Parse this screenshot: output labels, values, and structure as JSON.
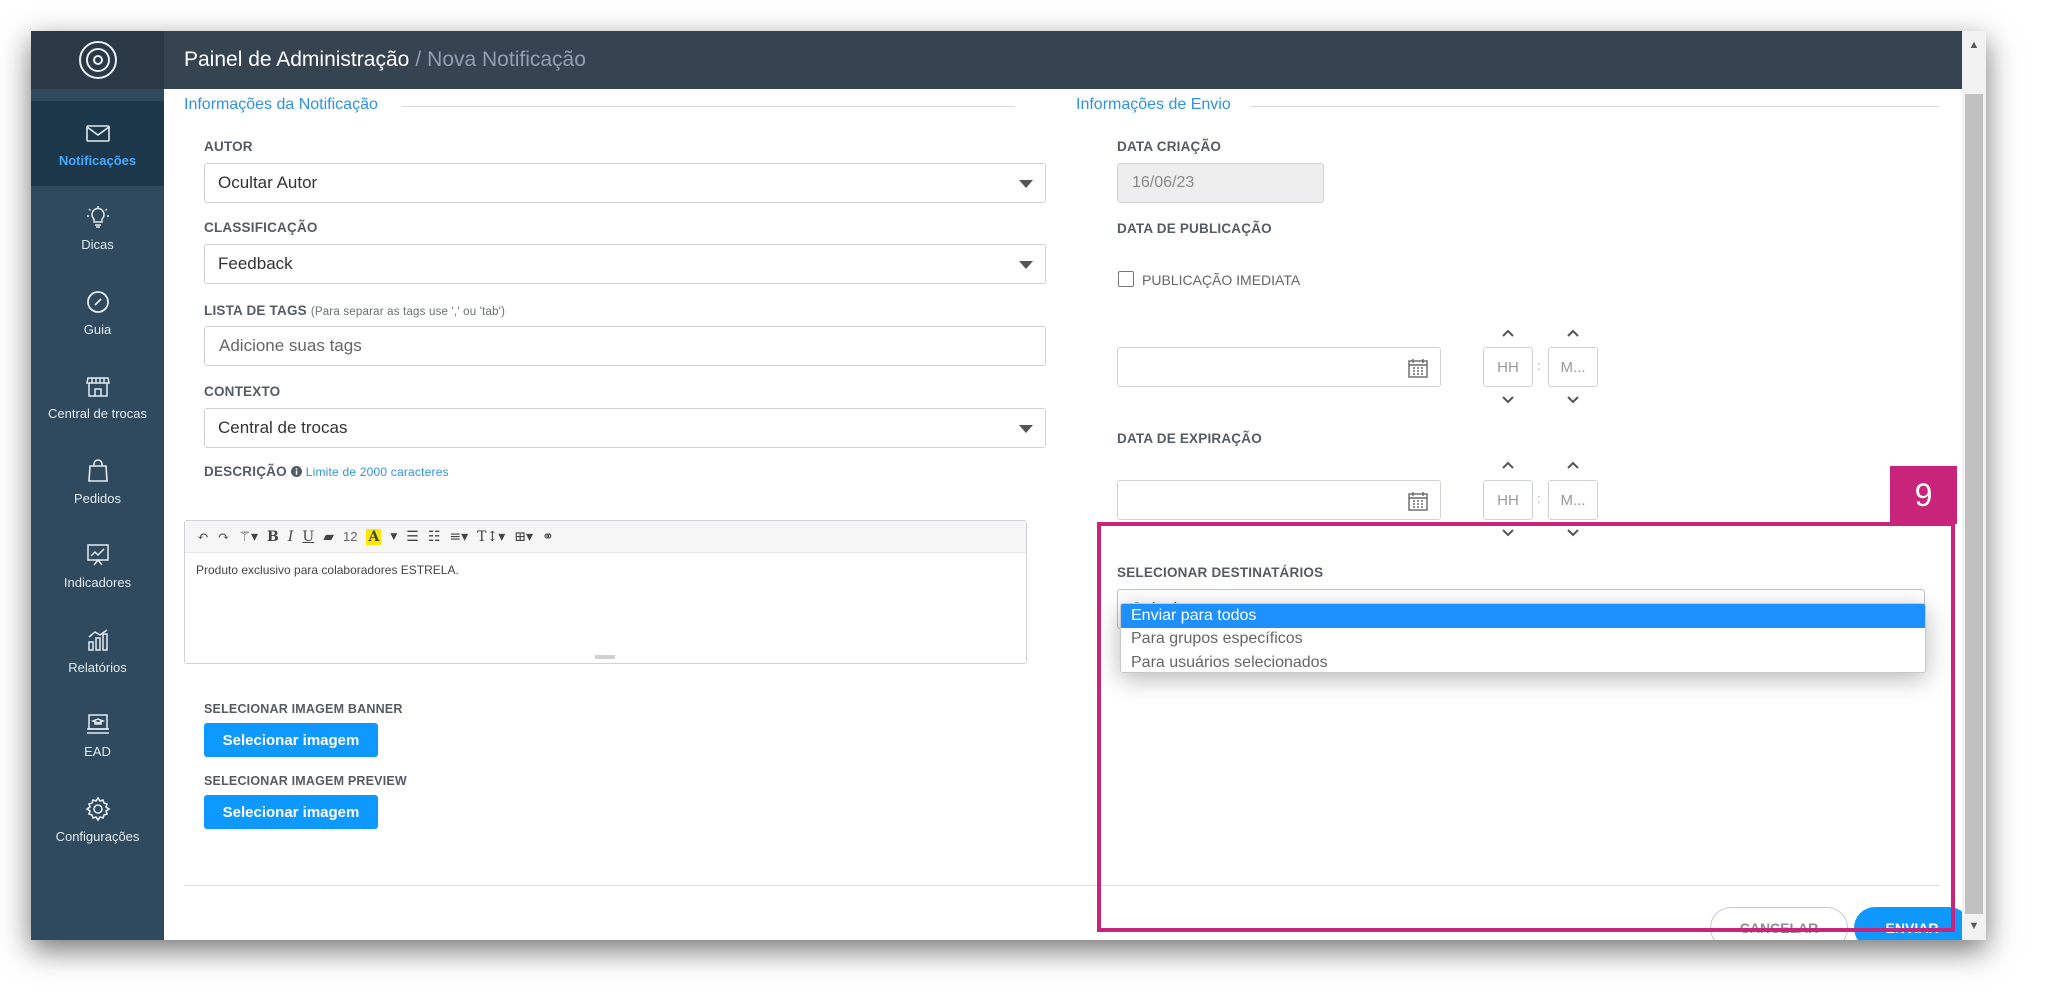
{
  "topbar": {
    "title": "Painel de Administração",
    "separator": "/",
    "subtitle": "Nova Notificação"
  },
  "sidebar": {
    "items": [
      {
        "label": "Notificações",
        "icon": "envelope-icon",
        "active": true
      },
      {
        "label": "Dicas",
        "icon": "lightbulb-icon"
      },
      {
        "label": "Guia",
        "icon": "compass-icon"
      },
      {
        "label": "Central de trocas",
        "icon": "storefront-icon"
      },
      {
        "label": "Pedidos",
        "icon": "shopping-bag-icon"
      },
      {
        "label": "Indicadores",
        "icon": "chart-board-icon"
      },
      {
        "label": "Relatórios",
        "icon": "bar-chart-icon"
      },
      {
        "label": "EAD",
        "icon": "laptop-hat-icon"
      },
      {
        "label": "Configurações",
        "icon": "gear-icon"
      }
    ]
  },
  "left": {
    "legend": "Informações da Notificação",
    "author": {
      "label": "AUTOR",
      "value": "Ocultar Autor"
    },
    "classification": {
      "label": "CLASSIFICAÇÃO",
      "value": "Feedback"
    },
    "tags": {
      "label": "LISTA DE TAGS",
      "hint": "(Para separar as tags use ',' ou 'tab')",
      "placeholder": "Adicione suas tags"
    },
    "context": {
      "label": "CONTEXTO",
      "value": "Central de trocas"
    },
    "description": {
      "label": "DESCRIÇÃO",
      "info_icon": "info-icon",
      "hint": "Limite de 2000 caracteres",
      "font_size": "12",
      "text": "Produto exclusivo para colaboradores ESTRELA."
    },
    "banner": {
      "label": "SELECIONAR IMAGEM BANNER",
      "button": "Selecionar imagem"
    },
    "preview": {
      "label": "SELECIONAR IMAGEM PREVIEW",
      "button": "Selecionar imagem"
    }
  },
  "right": {
    "legend": "Informações de Envio",
    "created": {
      "label": "DATA CRIAÇÃO",
      "value": "16/06/23"
    },
    "publication": {
      "label": "DATA DE PUBLICAÇÃO",
      "immediate_label": "PUBLICAÇÃO IMEDIATA",
      "immediate_checked": false,
      "hour_placeholder": "HH",
      "minute_placeholder": "M...",
      "time_sep": ":"
    },
    "expiration": {
      "label": "DATA DE EXPIRAÇÃO",
      "hour_placeholder": "HH",
      "minute_placeholder": "M...",
      "time_sep": ":"
    },
    "recipients": {
      "label": "SELECIONAR DESTINATÁRIOS",
      "value": "Selecione...",
      "options": [
        "Enviar para todos",
        "Para grupos específicos",
        "Para usuários selecionados"
      ],
      "highlighted_index": 0
    },
    "cancel": "CANCELAR",
    "send": "ENVIAR"
  },
  "annotation": {
    "step": "9",
    "color": "#c7247a"
  },
  "colors": {
    "accent": "#0d99ff",
    "sidebar": "#2f4a5f",
    "topbar": "#364351",
    "legend": "#2f91e6"
  }
}
